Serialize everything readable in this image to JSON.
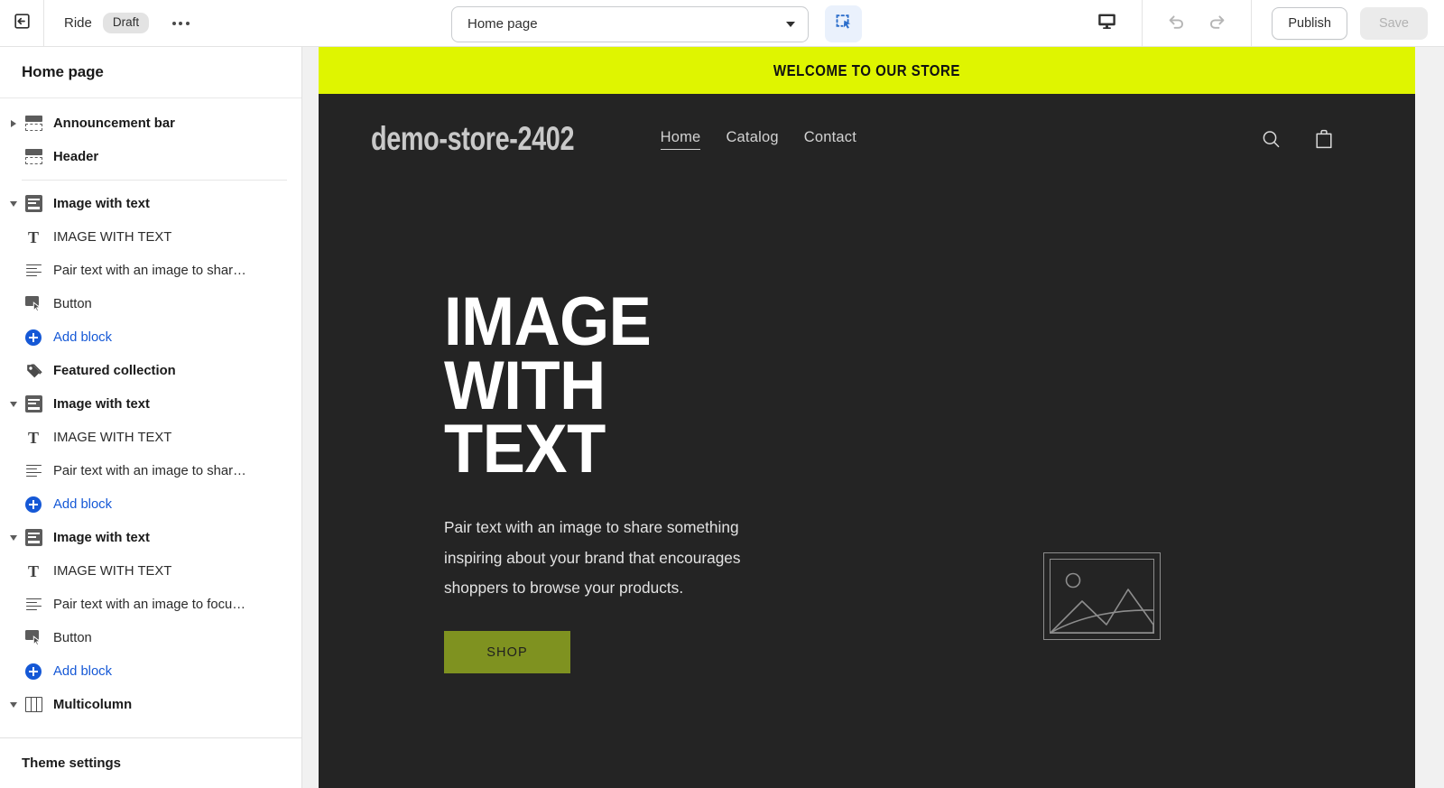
{
  "topbar": {
    "back_icon": "exit-left-icon",
    "theme_name": "Ride",
    "status_badge": "Draft",
    "more_icon": "more-horizontal-icon",
    "page_select": {
      "value": "Home page",
      "caret_icon": "chevron-down-icon"
    },
    "inspector_icon": "select-region-icon",
    "device_icon": "desktop-icon",
    "undo_icon": "undo-icon",
    "redo_icon": "redo-icon",
    "publish_label": "Publish",
    "save_label": "Save"
  },
  "sidebar": {
    "header": "Home page",
    "footer": "Theme settings",
    "add_block_label": "Add block",
    "rows": [
      {
        "label": "Announcement bar",
        "icon": "section-icon",
        "kind": "section",
        "disclosure": "collapsed"
      },
      {
        "label": "Header",
        "icon": "section-icon",
        "kind": "section",
        "disclosure": "none"
      },
      {
        "label": "Image with text",
        "icon": "image-with-text-icon",
        "kind": "section",
        "disclosure": "expanded"
      },
      {
        "label": "IMAGE WITH TEXT",
        "icon": "heading-icon",
        "kind": "block"
      },
      {
        "label": "Pair text with an image to shar…",
        "icon": "paragraph-icon",
        "kind": "block"
      },
      {
        "label": "Button",
        "icon": "button-icon",
        "kind": "block"
      },
      {
        "label": "Add block",
        "icon": "add-circle-icon",
        "kind": "addblock"
      },
      {
        "label": "Featured collection",
        "icon": "collection-tag-icon",
        "kind": "section",
        "disclosure": "none"
      },
      {
        "label": "Image with text",
        "icon": "image-with-text-icon",
        "kind": "section",
        "disclosure": "expanded"
      },
      {
        "label": "IMAGE WITH TEXT",
        "icon": "heading-icon",
        "kind": "block"
      },
      {
        "label": "Pair text with an image to shar…",
        "icon": "paragraph-icon",
        "kind": "block"
      },
      {
        "label": "Add block",
        "icon": "add-circle-icon",
        "kind": "addblock"
      },
      {
        "label": "Image with text",
        "icon": "image-with-text-icon",
        "kind": "section",
        "disclosure": "expanded"
      },
      {
        "label": "IMAGE WITH TEXT",
        "icon": "heading-icon",
        "kind": "block"
      },
      {
        "label": "Pair text with an image to focu…",
        "icon": "paragraph-icon",
        "kind": "block"
      },
      {
        "label": "Button",
        "icon": "button-icon",
        "kind": "block"
      },
      {
        "label": "Add block",
        "icon": "add-circle-icon",
        "kind": "addblock"
      },
      {
        "label": "Multicolumn",
        "icon": "multicolumn-icon",
        "kind": "section",
        "disclosure": "expanded"
      }
    ]
  },
  "preview": {
    "announcement": "WELCOME TO OUR STORE",
    "logo": "demo-store-2402",
    "nav": [
      {
        "label": "Home",
        "active": true
      },
      {
        "label": "Catalog",
        "active": false
      },
      {
        "label": "Contact",
        "active": false
      }
    ],
    "search_icon": "search-icon",
    "cart_icon": "shopping-bag-icon",
    "hero": {
      "heading": "IMAGE\nWITH TEXT",
      "paragraph": "Pair text with an image to share something inspiring about your brand that encourages shoppers to browse your products.",
      "button_label": "SHOP",
      "placeholder_icon": "image-placeholder-icon"
    }
  },
  "colors": {
    "announcement_bg": "#dff500",
    "preview_bg": "#242424",
    "button_bg": "#7f9220",
    "accent_link": "#1558d6",
    "inspector_active_bg": "#eaf1fc"
  }
}
